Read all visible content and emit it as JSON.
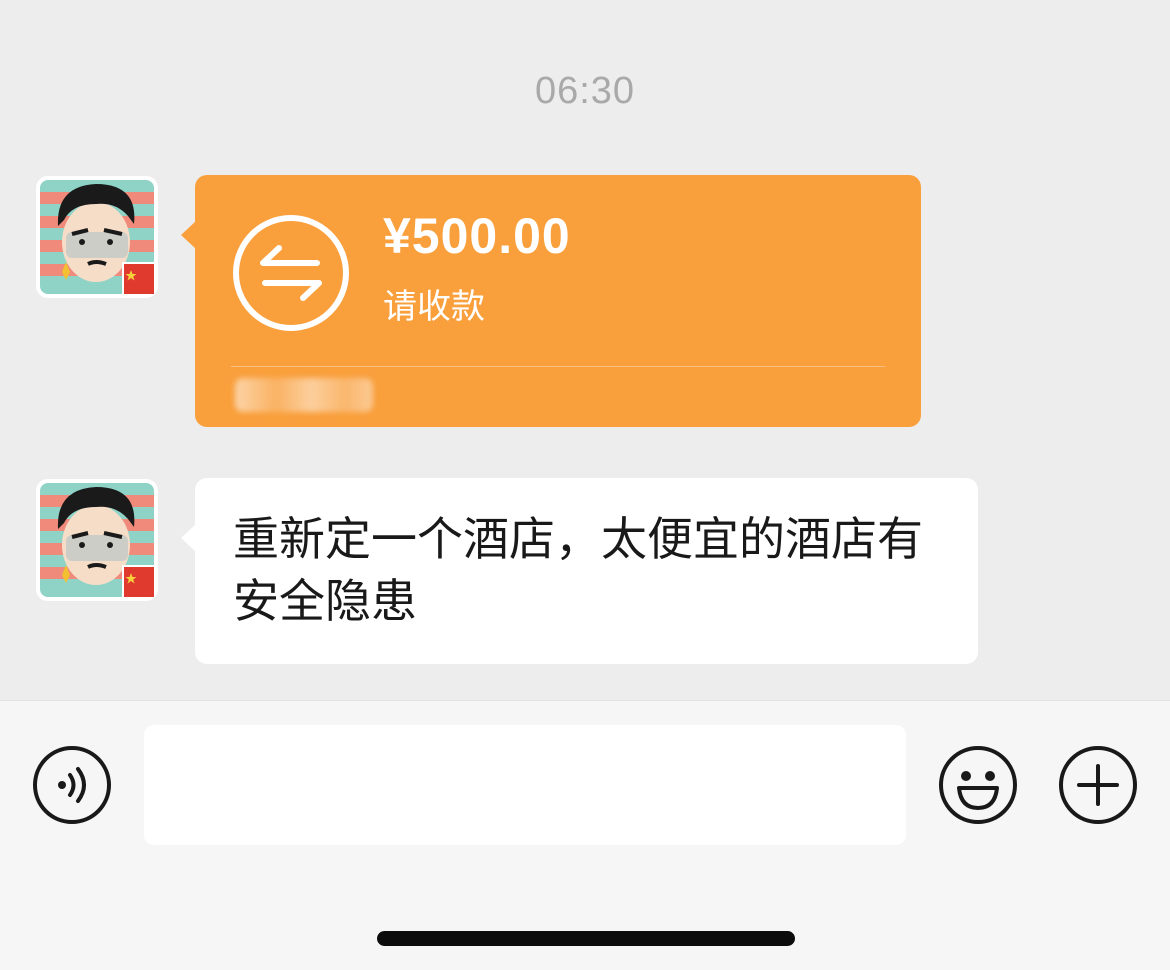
{
  "chat": {
    "timestamp": "06:30",
    "messages": [
      {
        "type": "transfer",
        "amount": "¥500.00",
        "status": "请收款",
        "icon": "transfer-arrows-icon"
      },
      {
        "type": "text",
        "text": "重新定一个酒店，太便宜的酒店有安全隐患"
      }
    ]
  },
  "input_bar": {
    "placeholder": "",
    "voice_icon": "voice-icon",
    "emoji_icon": "emoji-icon",
    "plus_icon": "plus-icon"
  },
  "colors": {
    "transfer_bubble": "#f99f3c",
    "chat_background": "#ededed",
    "input_bar_background": "#f6f6f6",
    "text_bubble": "#ffffff"
  }
}
